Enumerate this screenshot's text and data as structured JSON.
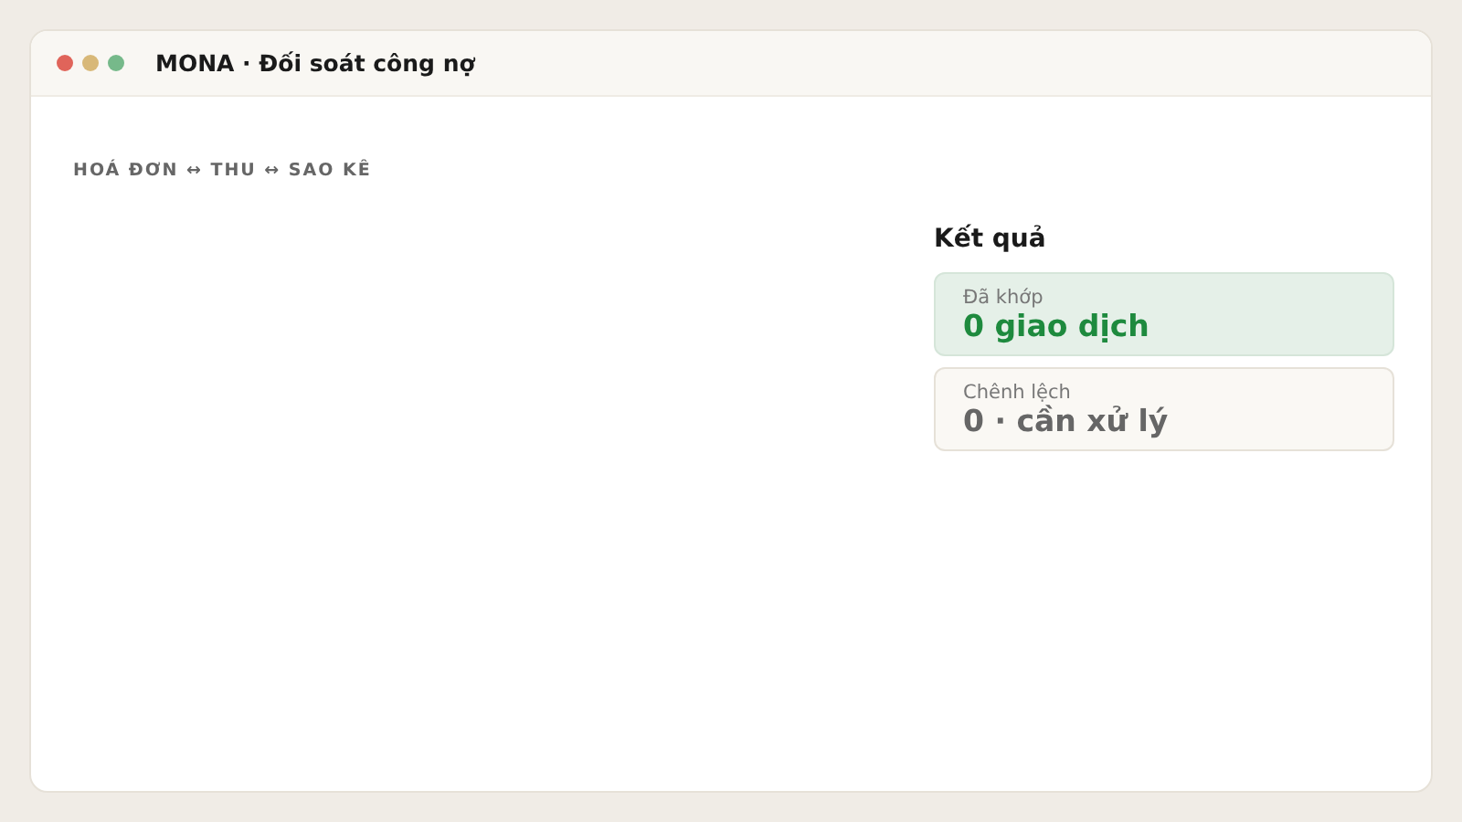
{
  "window": {
    "title": "MONA · Đối soát công nợ"
  },
  "breadcrumb": "HOÁ ĐƠN ↔ THU ↔ SAO KÊ",
  "results": {
    "heading": "Kết quả",
    "cards": [
      {
        "kind": "matched",
        "label": "Đã khớp",
        "value": "0 giao dịch"
      },
      {
        "kind": "difference",
        "label": "Chênh lệch",
        "value": "0 · cần xử lý"
      }
    ]
  }
}
